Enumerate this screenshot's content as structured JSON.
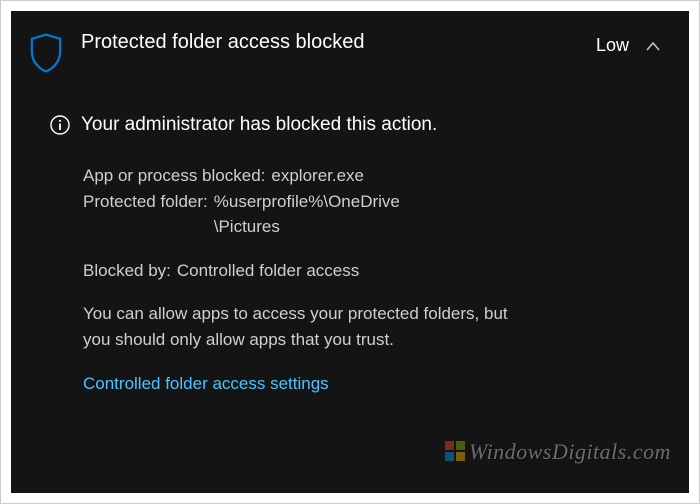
{
  "header": {
    "title": "Protected folder access blocked",
    "severity": "Low"
  },
  "admin_message": "Your administrator has blocked this action.",
  "details": {
    "app_label": "App or process blocked:",
    "app_value": "explorer.exe",
    "folder_label": "Protected folder:",
    "folder_value_line1": "%userprofile%\\OneDrive",
    "folder_value_line2": "\\Pictures",
    "blocked_by_label": "Blocked by:",
    "blocked_by_value": "Controlled folder access"
  },
  "description": "You can allow apps to access your protected folders, but you should only allow apps that you trust.",
  "link_label": "Controlled folder access settings",
  "watermark": "WindowsDigitals.com",
  "colors": {
    "background": "#141414",
    "accent_shield": "#0078d4",
    "link": "#4cc2ff",
    "text_secondary": "#cfcfcf"
  }
}
